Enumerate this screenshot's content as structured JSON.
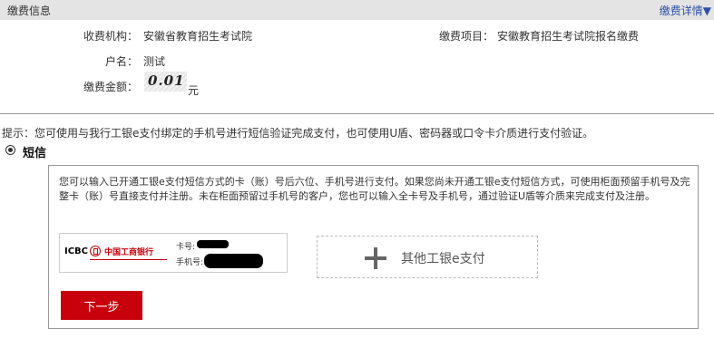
{
  "header": {
    "title": "缴费信息",
    "detail_link": "缴费详情▼"
  },
  "payment": {
    "org_label": "收费机构：",
    "org_value": "安徽省教育招生考试院",
    "item_label": "缴费项目：",
    "item_value": "安徽教育招生考试院报名缴费",
    "name_label": "户名：",
    "name_value": "测试",
    "amount_label": "缴费金额：",
    "amount_value": "0.01",
    "amount_unit": "元"
  },
  "tip": "提示：您可使用与我行工银e支付绑定的手机号进行短信验证完成支付，也可使用U盾、密码器或口令卡介质进行支付验证。",
  "method": {
    "label": "短信",
    "selected": true
  },
  "panel": {
    "description": "您可以输入已开通工银e支付短信方式的卡（账）号后六位、手机号进行支付。如果您尚未开通工银e支付短信方式，可使用柜面预留手机号及完整卡（账）号直接支付并注册。未在柜面预留过手机号的客户，您也可以输入全卡号及手机号，通过验证U盾等介质来完成支付及注册。",
    "card": {
      "bank_abbr": "ICBC",
      "bank_name": "中国工商银行",
      "card_label": "卡号:",
      "phone_label": "手机号:1"
    },
    "other_pay": "其他工银e支付",
    "next_button": "下一步"
  },
  "colors": {
    "brand_red": "#c7000b",
    "link_blue": "#2b4fa8",
    "header_bg": "#e4e4e4"
  }
}
